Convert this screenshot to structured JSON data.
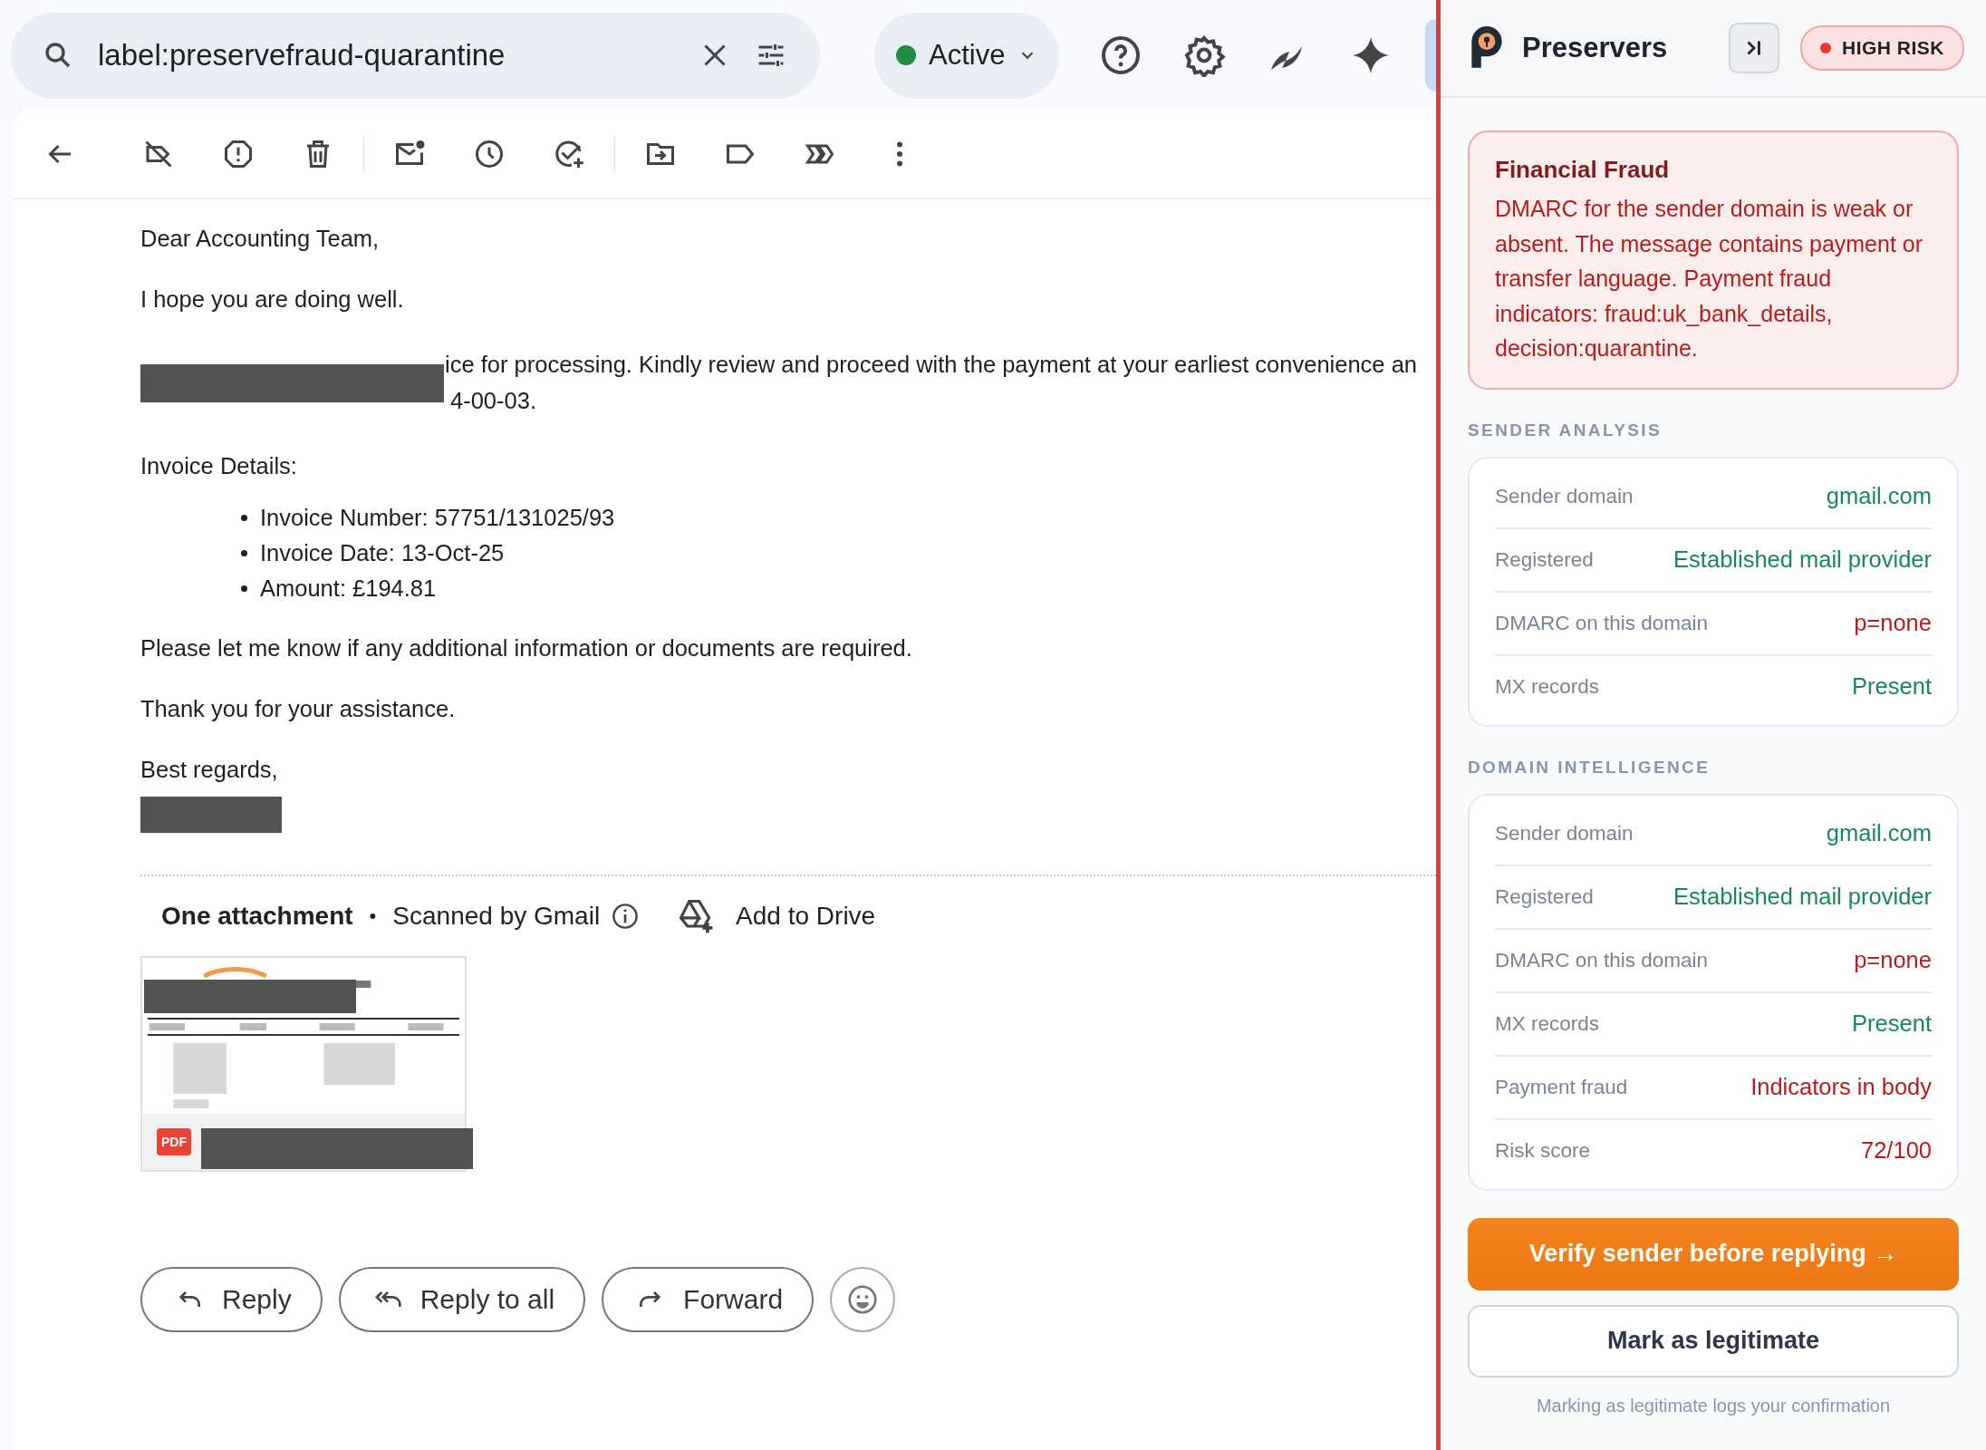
{
  "search": {
    "value": "label:preservefraud-quarantine"
  },
  "status": {
    "label": "Active",
    "online": true
  },
  "email": {
    "body": [
      {
        "kind": "p",
        "text": "Dear Accounting Team,"
      },
      {
        "kind": "p",
        "text": "I hope you are doing well."
      },
      {
        "kind": "covered",
        "lines": [
          "ice for processing. Kindly review and proceed with the payment at your earliest convenience an",
          "4-00-03."
        ]
      },
      {
        "kind": "p",
        "text": "Invoice Details:"
      },
      {
        "kind": "list",
        "items": [
          "Invoice Number: 57751/131025/93",
          "Invoice Date: 13-Oct-25",
          "Amount: £194.81"
        ]
      },
      {
        "kind": "p",
        "text": "Please let me know if any additional information or documents are required."
      },
      {
        "kind": "p",
        "text": "Thank you for your assistance."
      },
      {
        "kind": "p",
        "text": "Best regards,"
      },
      {
        "kind": "redaction"
      }
    ]
  },
  "attachment": {
    "title": "One attachment",
    "separator": "•",
    "scan_note": "Scanned by Gmail",
    "drive": "Add to Drive",
    "file": {
      "kind": "picture",
      "badge": "PDF"
    }
  },
  "replies": [
    {
      "kind": "reply",
      "label": "Reply"
    },
    {
      "kind": "reply-all",
      "label": "Reply to all"
    },
    {
      "kind": "forward",
      "label": "Forward"
    }
  ],
  "panel": {
    "brand": "Preservers",
    "risk": {
      "label": "HIGH RISK"
    },
    "alert": {
      "title": "Financial Fraud",
      "text": "DMARC for the sender domain is weak or absent. The message contains payment or transfer language. Payment fraud indicators: fraud:uk_bank_details, decision:quarantine."
    },
    "sections": [
      {
        "title": "SENDER ANALYSIS",
        "rows": [
          {
            "label": "Sender domain",
            "value": "gmail.com",
            "kind": "good"
          },
          {
            "label": "Registered",
            "value": "Established mail provider",
            "kind": "good"
          },
          {
            "label": "DMARC on this domain",
            "value": "p=none",
            "kind": "bad"
          },
          {
            "label": "MX records",
            "value": "Present",
            "kind": "good"
          }
        ]
      },
      {
        "title": "DOMAIN INTELLIGENCE",
        "rows": [
          {
            "label": "Sender domain",
            "value": "gmail.com",
            "kind": "good"
          },
          {
            "label": "Registered",
            "value": "Established mail provider",
            "kind": "good"
          },
          {
            "label": "DMARC on this domain",
            "value": "p=none",
            "kind": "bad"
          },
          {
            "label": "MX records",
            "value": "Present",
            "kind": "good"
          },
          {
            "label": "Payment fraud",
            "value": "Indicators in body",
            "kind": "bad"
          },
          {
            "label": "Risk score",
            "value": "72/100",
            "kind": "bad"
          }
        ]
      }
    ],
    "primary_action": "Verify sender before replying →",
    "secondary_action": "Mark as legitimate",
    "note": "Marking as legitimate logs your confirmation"
  }
}
